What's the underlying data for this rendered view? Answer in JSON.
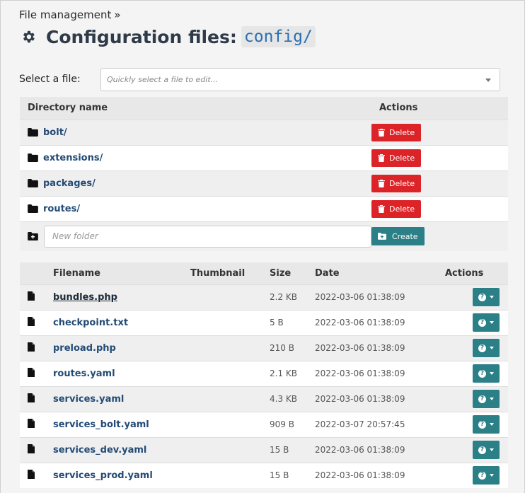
{
  "breadcrumb": {
    "label": "File management",
    "separator": "»"
  },
  "page": {
    "title": "Configuration files:",
    "path": "config/"
  },
  "file_select": {
    "label": "Select a file:",
    "placeholder": "Quickly select a file to edit..."
  },
  "directories": {
    "headers": {
      "name": "Directory name",
      "actions": "Actions"
    },
    "rows": [
      {
        "name": "bolt/",
        "action": "Delete"
      },
      {
        "name": "extensions/",
        "action": "Delete"
      },
      {
        "name": "packages/",
        "action": "Delete"
      },
      {
        "name": "routes/",
        "action": "Delete"
      }
    ],
    "new_folder": {
      "placeholder": "New folder",
      "button": "Create"
    }
  },
  "files": {
    "headers": {
      "filename": "Filename",
      "thumbnail": "Thumbnail",
      "size": "Size",
      "date": "Date",
      "actions": "Actions"
    },
    "rows": [
      {
        "name": "bundles.php",
        "size": "2.2 KB",
        "date": "2022-03-06 01:38:09"
      },
      {
        "name": "checkpoint.txt",
        "size": "5 B",
        "date": "2022-03-06 01:38:09"
      },
      {
        "name": "preload.php",
        "size": "210 B",
        "date": "2022-03-06 01:38:09"
      },
      {
        "name": "routes.yaml",
        "size": "2.1 KB",
        "date": "2022-03-06 01:38:09"
      },
      {
        "name": "services.yaml",
        "size": "4.3 KB",
        "date": "2022-03-06 01:38:09"
      },
      {
        "name": "services_bolt.yaml",
        "size": "909 B",
        "date": "2022-03-07 20:57:45"
      },
      {
        "name": "services_dev.yaml",
        "size": "15 B",
        "date": "2022-03-06 01:38:09"
      },
      {
        "name": "services_prod.yaml",
        "size": "15 B",
        "date": "2022-03-06 01:38:09"
      }
    ]
  },
  "colors": {
    "danger": "#dc2328",
    "primary": "#2b7f86",
    "link": "#234b75"
  },
  "icons": {
    "title": "gear-icon",
    "directory": "folder-icon",
    "file": "file-icon",
    "delete": "trash-icon",
    "new_folder": "folder-plus-icon",
    "action": "question-icon"
  }
}
